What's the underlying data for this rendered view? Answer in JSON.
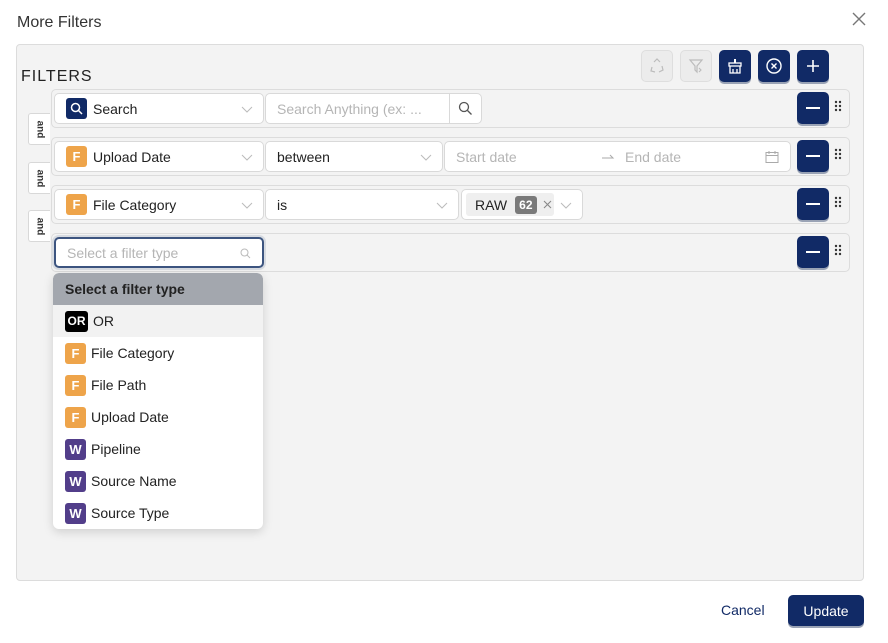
{
  "dialog": {
    "title": "More Filters",
    "close_icon": "close-icon"
  },
  "panel": {
    "label": "FILTERS",
    "toolbar": [
      {
        "name": "recycle-icon",
        "state": "disabled"
      },
      {
        "name": "filter-clear-icon",
        "state": "disabled"
      },
      {
        "name": "broom-icon",
        "state": "enabled"
      },
      {
        "name": "circle-x-icon",
        "state": "enabled"
      },
      {
        "name": "plus-icon",
        "state": "enabled"
      }
    ],
    "connectors": [
      "and",
      "and",
      "and"
    ],
    "rows": [
      {
        "field_badge": "Q",
        "field_badge_type": "search",
        "field": "Search",
        "input_placeholder": "Search Anything (ex: ..."
      },
      {
        "field_badge": "F",
        "field_badge_type": "F",
        "field": "Upload Date",
        "operator": "between",
        "start_placeholder": "Start date",
        "end_placeholder": "End date"
      },
      {
        "field_badge": "F",
        "field_badge_type": "F",
        "field": "File Category",
        "operator": "is",
        "tag_value": "RAW",
        "tag_count": "62"
      },
      {
        "field_placeholder": "Select a filter type"
      }
    ]
  },
  "dropdown": {
    "header": "Select a filter type",
    "items": [
      {
        "badge": "OR",
        "label": "OR",
        "type": "or"
      },
      {
        "badge": "F",
        "label": "File Category",
        "type": "f"
      },
      {
        "badge": "F",
        "label": "File Path",
        "type": "f"
      },
      {
        "badge": "F",
        "label": "Upload Date",
        "type": "f"
      },
      {
        "badge": "W",
        "label": "Pipeline",
        "type": "w"
      },
      {
        "badge": "W",
        "label": "Source Name",
        "type": "w"
      },
      {
        "badge": "W",
        "label": "Source Type",
        "type": "w"
      }
    ]
  },
  "footer": {
    "cancel_label": "Cancel",
    "update_label": "Update"
  },
  "colors": {
    "primary": "#112a66",
    "badge_f": "#eea44a",
    "badge_w": "#523e8a",
    "panel_bg": "#f3f3f3"
  }
}
